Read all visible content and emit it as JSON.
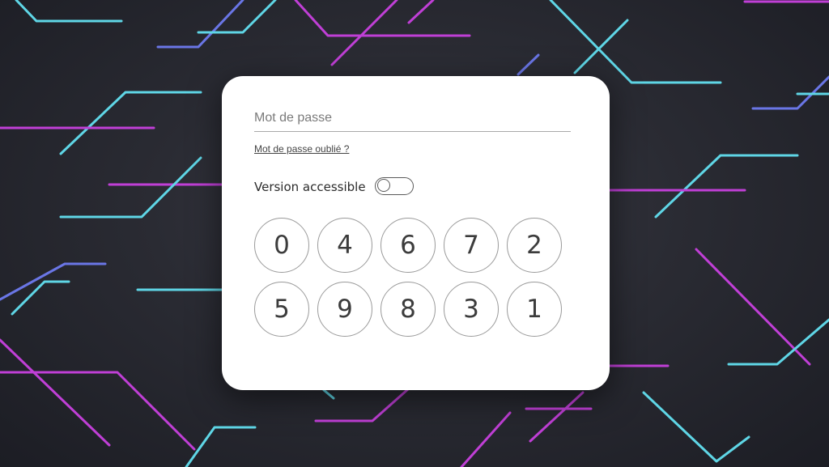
{
  "colors": {
    "background": "#25262e",
    "line_cyan": "#5fd6e6",
    "line_magenta": "#c03fd6",
    "line_blue": "#6a76e6",
    "card": "#ffffff"
  },
  "login": {
    "password_placeholder": "Mot de passe",
    "password_value": "",
    "forgot_link": "Mot de passe oublié ?",
    "accessible_label": "Version accessible",
    "accessible_toggle_on": false
  },
  "keypad": {
    "keys": [
      "0",
      "4",
      "6",
      "7",
      "2",
      "5",
      "9",
      "8",
      "3",
      "1"
    ]
  }
}
